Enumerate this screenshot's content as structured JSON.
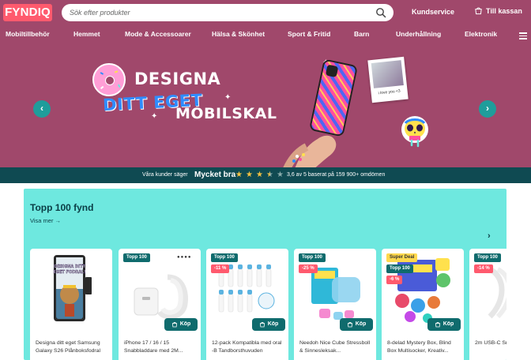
{
  "header": {
    "logo": "FYNDIQ",
    "search_placeholder": "Sök efter produkter",
    "customer_service": "Kundservice",
    "cart_label": "Till kassan"
  },
  "nav": {
    "items": [
      {
        "label": "Mobiltillbehör"
      },
      {
        "label": "Hemmet"
      },
      {
        "label": "Mode & Accessoarer"
      },
      {
        "label": "Hälsa & Skönhet"
      },
      {
        "label": "Sport & Fritid"
      },
      {
        "label": "Barn"
      },
      {
        "label": "Underhållning"
      },
      {
        "label": "Elektronik"
      }
    ]
  },
  "hero": {
    "line1": "DESIGNA",
    "line2": "DITT EGET",
    "line3": "MOBILSKAL",
    "polaroid_caption": "i love you <3"
  },
  "rating": {
    "prefix": "Våra kunder säger",
    "verdict": "Mycket bra",
    "score_text": "3,6 av 5 baserat på 159 900+ omdömen",
    "stars": 3.6
  },
  "section": {
    "title": "Topp 100 fynd",
    "view_more": "Visa mer",
    "buy_label": "Köp",
    "products": [
      {
        "title": "Designa ditt eget Samsung Galaxy S26 Plånboksfodral",
        "badges": []
      },
      {
        "title": "iPhone 17 / 16 / 15 Snabbladdare med 2M...",
        "badges": [
          "Topp 100"
        ]
      },
      {
        "title": "12-pack Kompatibla med oral -B Tandborsthuvuden",
        "badges": [
          "Topp 100",
          "-11 %"
        ]
      },
      {
        "title": "Needoh Nice Cube Stressboll & Sinnesleksak...",
        "badges": [
          "Topp 100",
          "-25 %"
        ]
      },
      {
        "title": "8-delad Mystery Box, Blind Box Multisocker, Kreativ...",
        "badges": [
          "Super Deal",
          "Topp 100",
          "-6 %"
        ]
      },
      {
        "title": "2m USB-C Snabbladd...",
        "badges": [
          "Topp 100",
          "-14 %"
        ]
      }
    ]
  },
  "colors": {
    "header_bg": "#a0486b",
    "logo_bg": "#ff5a6e",
    "section_bg": "#6ee8df",
    "rating_bar_bg": "#0f4a52",
    "accent_teal": "#0f6b6d",
    "star": "#f5c242"
  }
}
